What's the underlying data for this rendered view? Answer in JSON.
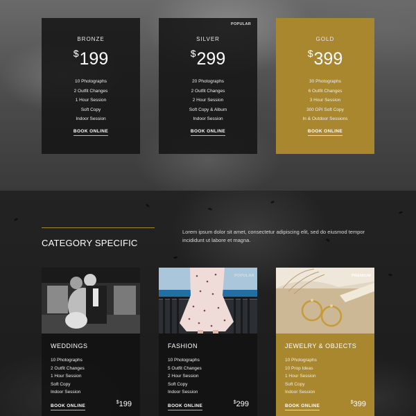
{
  "pricing": [
    {
      "tier": "BRONZE",
      "currency": "$",
      "amount": "199",
      "features": [
        "10 Photographs",
        "2 Outfit Changes",
        "1 Hour Session",
        "Soft Copy",
        "Indoor Session"
      ],
      "book_label": "BOOK ONLINE"
    },
    {
      "tier": "SILVER",
      "badge": "POPULAR",
      "currency": "$",
      "amount": "299",
      "features": [
        "20 Photographs",
        "2 Outfit Changes",
        "2 Hour Session",
        "Soft Copy & Album",
        "Indoor Session"
      ],
      "book_label": "BOOK ONLINE"
    },
    {
      "tier": "GOLD",
      "currency": "$",
      "amount": "399",
      "features": [
        "30 Photographs",
        "6 Outfit Changes",
        "3 Hour Session",
        "300 DPI Soft Copy",
        "In & Outdoor Sessions"
      ],
      "book_label": "BOOK ONLINE"
    }
  ],
  "category": {
    "title": "CATEGORY SPECIFIC",
    "description": "Lorem ipsum dolor sit amet, consectetur adipiscing elit, sed do eiusmod tempor incididunt ut labore et magna.",
    "cards": [
      {
        "name": "WEDDINGS",
        "photo": "wedding-couple-photo",
        "features": [
          "10 Photographs",
          "2 Outfit Changes",
          "1 Hour Session",
          "Soft Copy",
          "Indoor Session"
        ],
        "book_label": "BOOK ONLINE",
        "currency": "$",
        "amount": "199"
      },
      {
        "name": "FASHION",
        "photo": "fashion-dress-photo",
        "badge": "POPULAR",
        "features": [
          "10 Photographs",
          "5 Outfit Changes",
          "2 Hour Session",
          "Soft Copy",
          "Indoor Session"
        ],
        "book_label": "BOOK ONLINE",
        "currency": "$",
        "amount": "299"
      },
      {
        "name": "JEWELRY & OBJECTS",
        "photo": "jewelry-earrings-photo",
        "badge": "PREMIUM",
        "features": [
          "10 Photographs",
          "10 Prop Ideas",
          "1 Hour Session",
          "Soft Copy",
          "Indoor Session"
        ],
        "book_label": "BOOK ONLINE",
        "currency": "$",
        "amount": "399"
      }
    ]
  },
  "colors": {
    "gold_accent": "#a9872f",
    "card_dark": "#141414",
    "page_background": "#1d1d1d"
  }
}
